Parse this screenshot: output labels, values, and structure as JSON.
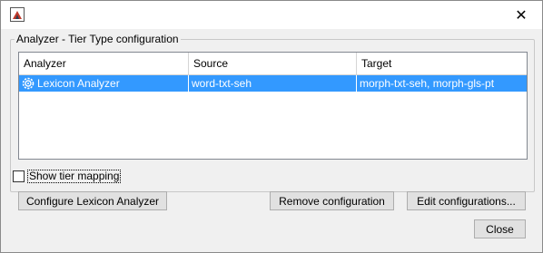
{
  "window": {
    "title": "",
    "close_glyph": "✕"
  },
  "group": {
    "title": "Analyzer - Tier Type configuration"
  },
  "table": {
    "columns": [
      "Analyzer",
      "Source",
      "Target"
    ],
    "rows": [
      {
        "icon": "gear-icon",
        "analyzer": "Lexicon Analyzer",
        "source": "word-txt-seh",
        "target": "morph-txt-seh, morph-gls-pt",
        "selected": true
      }
    ],
    "selection_color": "#3399ff"
  },
  "show_tier_mapping": {
    "label": "Show tier mapping",
    "checked": false
  },
  "buttons": {
    "configure": "Configure Lexicon Analyzer",
    "remove": "Remove configuration",
    "edit": "Edit configurations...",
    "close": "Close"
  }
}
